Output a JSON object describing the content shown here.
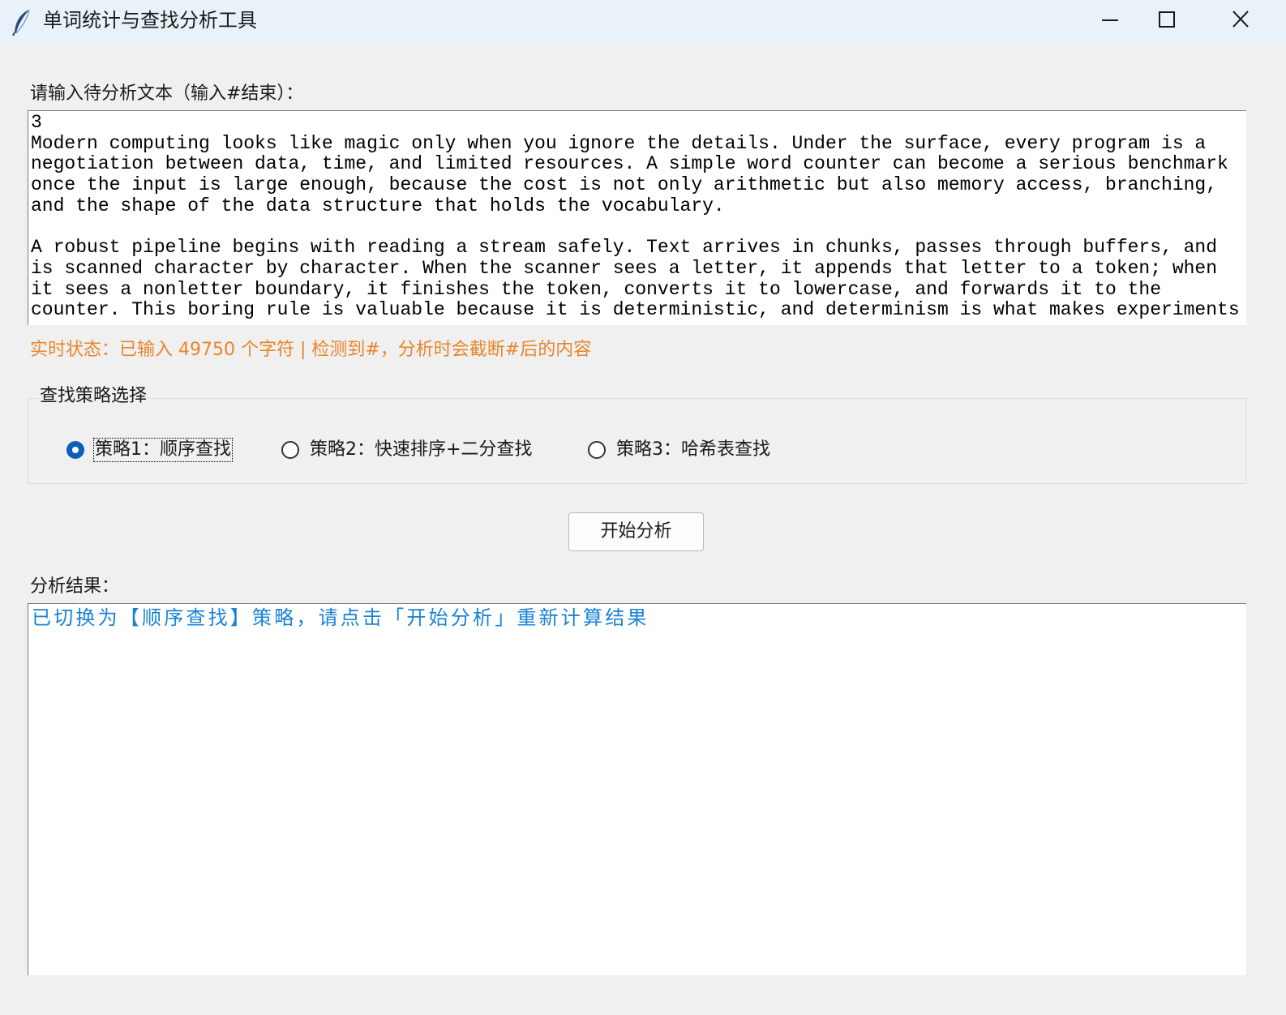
{
  "window": {
    "title": "单词统计与查找分析工具",
    "icon": "feather-icon",
    "controls": [
      "minimize-icon",
      "maximize-icon",
      "close-icon"
    ]
  },
  "input": {
    "label": "请输入待分析文本（输入#结束）：",
    "text": "3\nModern computing looks like magic only when you ignore the details. Under the surface, every program is a\nnegotiation between data, time, and limited resources. A simple word counter can become a serious benchmark\nonce the input is large enough, because the cost is not only arithmetic but also memory access, branching,\nand the shape of the data structure that holds the vocabulary.\n\nA robust pipeline begins with reading a stream safely. Text arrives in chunks, passes through buffers, and\nis scanned character by character. When the scanner sees a letter, it appends that letter to a token; when\nit sees a nonletter boundary, it finishes the token, converts it to lowercase, and forwards it to the\ncounter. This boring rule is valuable because it is deterministic, and determinism is what makes experiments"
  },
  "status": {
    "text": "实时状态：已输入 49750 个字符 | 检测到#，分析时会截断#后的内容",
    "color": "#e8862a"
  },
  "strategy": {
    "group_title": "查找策略选择",
    "options": [
      {
        "label": "策略1：顺序查找",
        "checked": true
      },
      {
        "label": "策略2：快速排序+二分查找",
        "checked": false
      },
      {
        "label": "策略3：哈希表查找",
        "checked": false
      }
    ]
  },
  "actions": {
    "start_label": "开始分析"
  },
  "result": {
    "label": "分析结果：",
    "text": "已切换为【顺序查找】策略，请点击「开始分析」重新计算结果",
    "color": "#1a82d6"
  },
  "colors": {
    "accent": "#0a5fb8",
    "titlebar": "#eaf2f9",
    "background": "#f0f0f0"
  }
}
